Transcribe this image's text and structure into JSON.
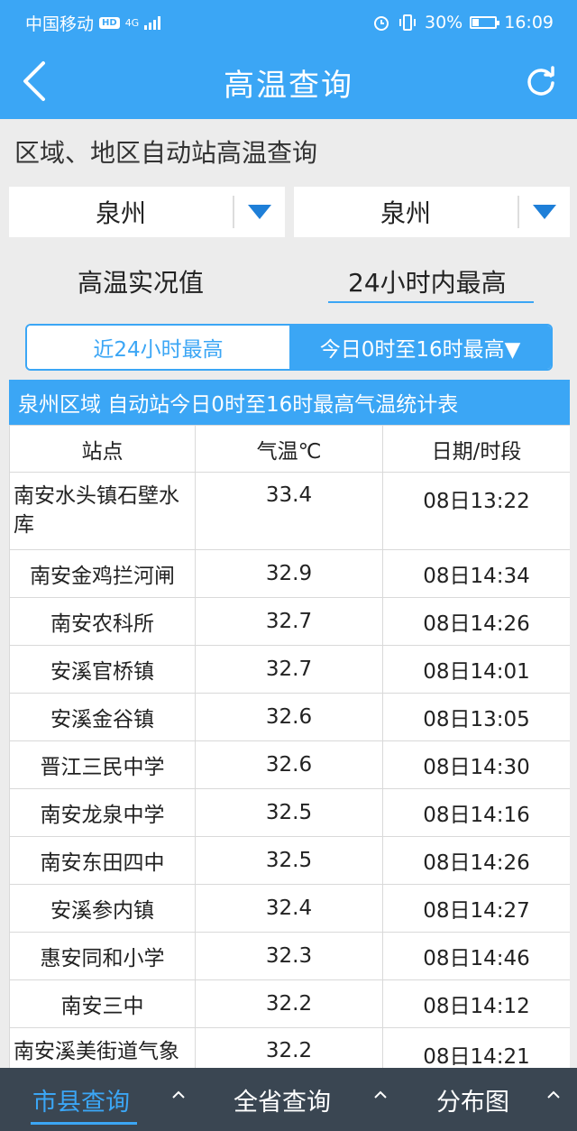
{
  "status_bar": {
    "carrier": "中国移动",
    "hd": "HD",
    "network": "4G",
    "battery": "30%",
    "time": "16:09"
  },
  "header": {
    "title": "高温查询",
    "back_icon": "chevron-left-icon",
    "refresh_icon": "refresh-icon"
  },
  "query": {
    "section_title": "区域、地区自动站高温查询",
    "region_select": "泉州",
    "area_select": "泉州",
    "mode_left": "高温实况值",
    "mode_right": "24小时内最高",
    "seg_left": "近24小时最高",
    "seg_right": "今日0时至16时最高▼"
  },
  "table": {
    "caption": "泉州区域 自动站今日0时至16时最高气温统计表",
    "headers": [
      "站点",
      "气温℃",
      "日期/时段"
    ],
    "rows": [
      {
        "station": "南安水头镇石壁水库",
        "temp": "33.4",
        "time": "08日13:22"
      },
      {
        "station": "南安金鸡拦河闸",
        "temp": "32.9",
        "time": "08日14:34"
      },
      {
        "station": "南安农科所",
        "temp": "32.7",
        "time": "08日14:26"
      },
      {
        "station": "安溪官桥镇",
        "temp": "32.7",
        "time": "08日14:01"
      },
      {
        "station": "安溪金谷镇",
        "temp": "32.6",
        "time": "08日13:05"
      },
      {
        "station": "晋江三民中学",
        "temp": "32.6",
        "time": "08日14:30"
      },
      {
        "station": "南安龙泉中学",
        "temp": "32.5",
        "time": "08日14:16"
      },
      {
        "station": "南安东田四中",
        "temp": "32.5",
        "time": "08日14:26"
      },
      {
        "station": "安溪参内镇",
        "temp": "32.4",
        "time": "08日14:27"
      },
      {
        "station": "惠安同和小学",
        "temp": "32.3",
        "time": "08日14:46"
      },
      {
        "station": "南安三中",
        "temp": "32.2",
        "time": "08日14:12"
      },
      {
        "station": "南安溪美街道气象",
        "temp": "32.2",
        "time": "08日14:21"
      }
    ]
  },
  "bottom_nav": {
    "items": [
      "市县查询",
      "全省查询",
      "分布图"
    ],
    "caret_icon": "caret-up-icon"
  },
  "colors": {
    "primary": "#3ba6f5",
    "nav_bg": "#3a4652",
    "page_bg": "#ececec"
  }
}
